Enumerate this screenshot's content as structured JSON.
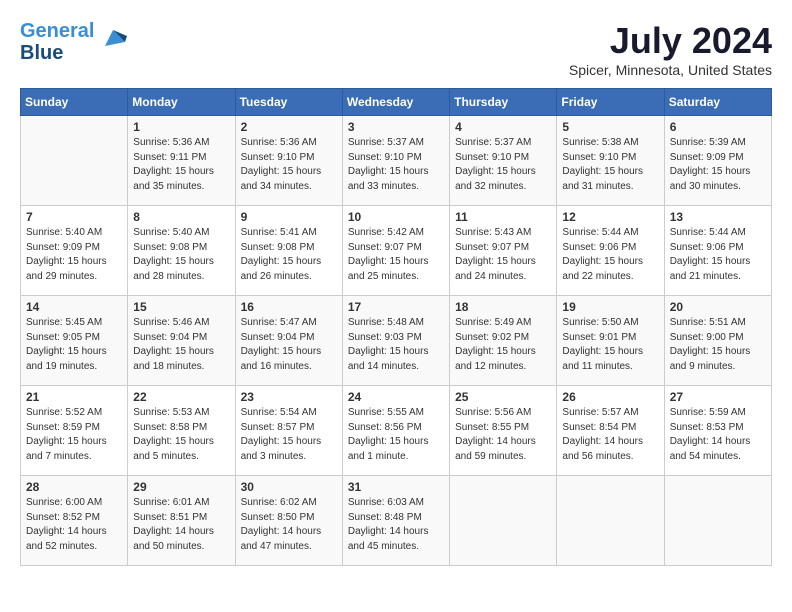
{
  "header": {
    "logo_line1": "General",
    "logo_line2": "Blue",
    "month_year": "July 2024",
    "location": "Spicer, Minnesota, United States"
  },
  "days_of_week": [
    "Sunday",
    "Monday",
    "Tuesday",
    "Wednesday",
    "Thursday",
    "Friday",
    "Saturday"
  ],
  "weeks": [
    [
      {
        "day": "",
        "content": ""
      },
      {
        "day": "1",
        "content": "Sunrise: 5:36 AM\nSunset: 9:11 PM\nDaylight: 15 hours\nand 35 minutes."
      },
      {
        "day": "2",
        "content": "Sunrise: 5:36 AM\nSunset: 9:10 PM\nDaylight: 15 hours\nand 34 minutes."
      },
      {
        "day": "3",
        "content": "Sunrise: 5:37 AM\nSunset: 9:10 PM\nDaylight: 15 hours\nand 33 minutes."
      },
      {
        "day": "4",
        "content": "Sunrise: 5:37 AM\nSunset: 9:10 PM\nDaylight: 15 hours\nand 32 minutes."
      },
      {
        "day": "5",
        "content": "Sunrise: 5:38 AM\nSunset: 9:10 PM\nDaylight: 15 hours\nand 31 minutes."
      },
      {
        "day": "6",
        "content": "Sunrise: 5:39 AM\nSunset: 9:09 PM\nDaylight: 15 hours\nand 30 minutes."
      }
    ],
    [
      {
        "day": "7",
        "content": "Sunrise: 5:40 AM\nSunset: 9:09 PM\nDaylight: 15 hours\nand 29 minutes."
      },
      {
        "day": "8",
        "content": "Sunrise: 5:40 AM\nSunset: 9:08 PM\nDaylight: 15 hours\nand 28 minutes."
      },
      {
        "day": "9",
        "content": "Sunrise: 5:41 AM\nSunset: 9:08 PM\nDaylight: 15 hours\nand 26 minutes."
      },
      {
        "day": "10",
        "content": "Sunrise: 5:42 AM\nSunset: 9:07 PM\nDaylight: 15 hours\nand 25 minutes."
      },
      {
        "day": "11",
        "content": "Sunrise: 5:43 AM\nSunset: 9:07 PM\nDaylight: 15 hours\nand 24 minutes."
      },
      {
        "day": "12",
        "content": "Sunrise: 5:44 AM\nSunset: 9:06 PM\nDaylight: 15 hours\nand 22 minutes."
      },
      {
        "day": "13",
        "content": "Sunrise: 5:44 AM\nSunset: 9:06 PM\nDaylight: 15 hours\nand 21 minutes."
      }
    ],
    [
      {
        "day": "14",
        "content": "Sunrise: 5:45 AM\nSunset: 9:05 PM\nDaylight: 15 hours\nand 19 minutes."
      },
      {
        "day": "15",
        "content": "Sunrise: 5:46 AM\nSunset: 9:04 PM\nDaylight: 15 hours\nand 18 minutes."
      },
      {
        "day": "16",
        "content": "Sunrise: 5:47 AM\nSunset: 9:04 PM\nDaylight: 15 hours\nand 16 minutes."
      },
      {
        "day": "17",
        "content": "Sunrise: 5:48 AM\nSunset: 9:03 PM\nDaylight: 15 hours\nand 14 minutes."
      },
      {
        "day": "18",
        "content": "Sunrise: 5:49 AM\nSunset: 9:02 PM\nDaylight: 15 hours\nand 12 minutes."
      },
      {
        "day": "19",
        "content": "Sunrise: 5:50 AM\nSunset: 9:01 PM\nDaylight: 15 hours\nand 11 minutes."
      },
      {
        "day": "20",
        "content": "Sunrise: 5:51 AM\nSunset: 9:00 PM\nDaylight: 15 hours\nand 9 minutes."
      }
    ],
    [
      {
        "day": "21",
        "content": "Sunrise: 5:52 AM\nSunset: 8:59 PM\nDaylight: 15 hours\nand 7 minutes."
      },
      {
        "day": "22",
        "content": "Sunrise: 5:53 AM\nSunset: 8:58 PM\nDaylight: 15 hours\nand 5 minutes."
      },
      {
        "day": "23",
        "content": "Sunrise: 5:54 AM\nSunset: 8:57 PM\nDaylight: 15 hours\nand 3 minutes."
      },
      {
        "day": "24",
        "content": "Sunrise: 5:55 AM\nSunset: 8:56 PM\nDaylight: 15 hours\nand 1 minute."
      },
      {
        "day": "25",
        "content": "Sunrise: 5:56 AM\nSunset: 8:55 PM\nDaylight: 14 hours\nand 59 minutes."
      },
      {
        "day": "26",
        "content": "Sunrise: 5:57 AM\nSunset: 8:54 PM\nDaylight: 14 hours\nand 56 minutes."
      },
      {
        "day": "27",
        "content": "Sunrise: 5:59 AM\nSunset: 8:53 PM\nDaylight: 14 hours\nand 54 minutes."
      }
    ],
    [
      {
        "day": "28",
        "content": "Sunrise: 6:00 AM\nSunset: 8:52 PM\nDaylight: 14 hours\nand 52 minutes."
      },
      {
        "day": "29",
        "content": "Sunrise: 6:01 AM\nSunset: 8:51 PM\nDaylight: 14 hours\nand 50 minutes."
      },
      {
        "day": "30",
        "content": "Sunrise: 6:02 AM\nSunset: 8:50 PM\nDaylight: 14 hours\nand 47 minutes."
      },
      {
        "day": "31",
        "content": "Sunrise: 6:03 AM\nSunset: 8:48 PM\nDaylight: 14 hours\nand 45 minutes."
      },
      {
        "day": "",
        "content": ""
      },
      {
        "day": "",
        "content": ""
      },
      {
        "day": "",
        "content": ""
      }
    ]
  ]
}
